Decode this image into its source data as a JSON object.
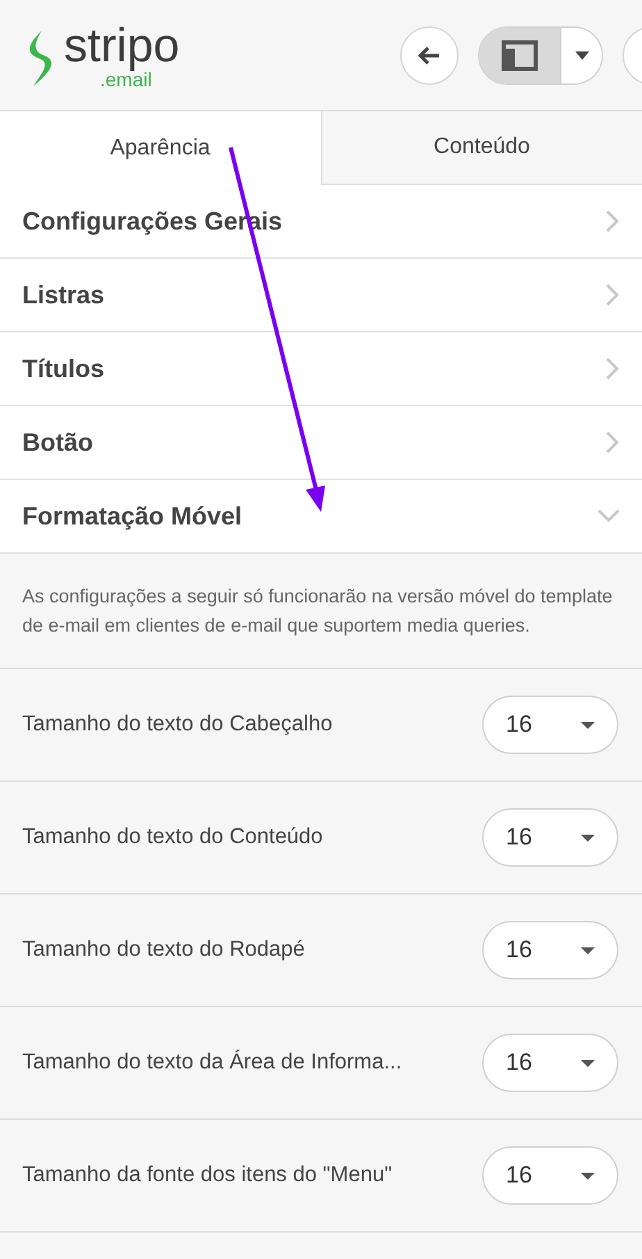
{
  "logo": {
    "wordmark": "stripo",
    "suffix": ".email"
  },
  "tabs": [
    {
      "label": "Aparência",
      "selected": true
    },
    {
      "label": "Conteúdo",
      "selected": false
    }
  ],
  "sections": [
    {
      "title": "Configurações Gerais",
      "expanded": false
    },
    {
      "title": "Listras",
      "expanded": false
    },
    {
      "title": "Títulos",
      "expanded": false
    },
    {
      "title": "Botão",
      "expanded": false
    },
    {
      "title": "Formatação Móvel",
      "expanded": true
    }
  ],
  "mobile_note": "As configurações a seguir só funcionarão na versão móvel do template de e-mail em clientes de e-mail que suportem media queries.",
  "settings": [
    {
      "label": "Tamanho do texto do Cabeçalho",
      "value": "16"
    },
    {
      "label": "Tamanho do texto do Conteúdo",
      "value": "16"
    },
    {
      "label": "Tamanho do texto do Rodapé",
      "value": "16"
    },
    {
      "label": "Tamanho do texto da Área de Informa...",
      "value": "16"
    },
    {
      "label": "Tamanho da fonte dos itens do \"Menu\"",
      "value": "16"
    }
  ]
}
